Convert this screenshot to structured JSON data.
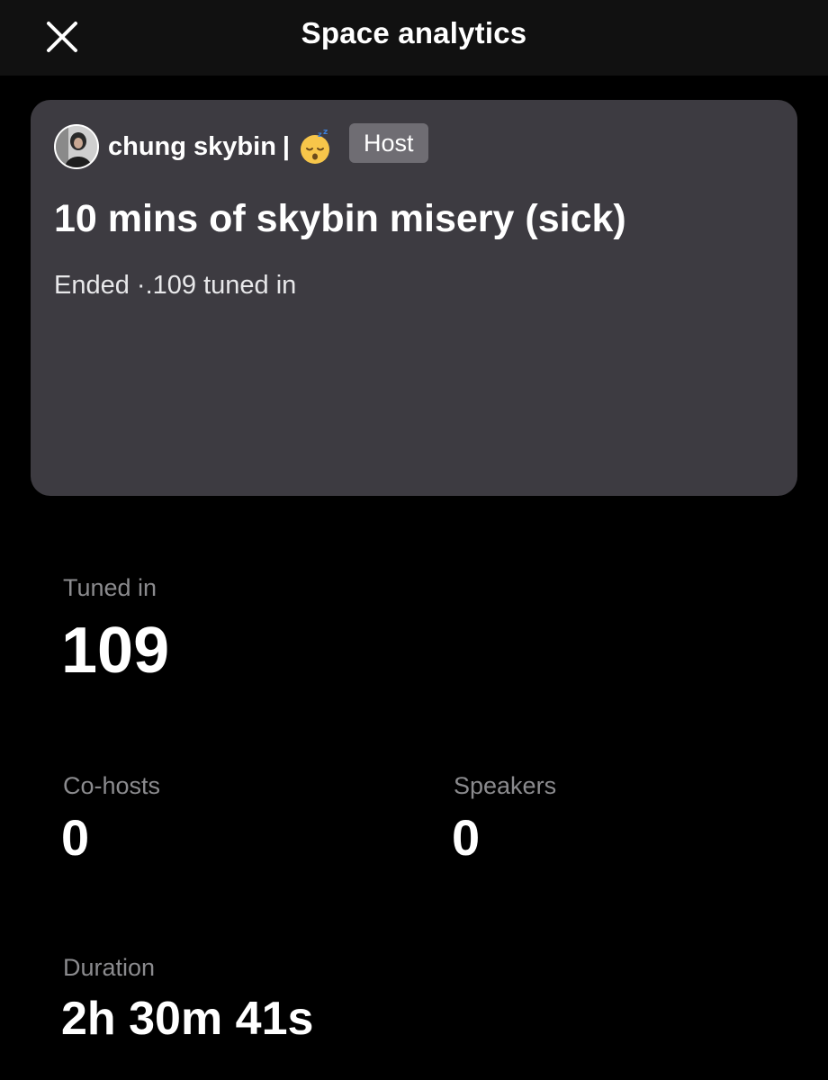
{
  "header": {
    "title": "Space analytics",
    "close_icon": "close-icon"
  },
  "space": {
    "host_name": "chung skybin",
    "host_separator": "|",
    "host_emoji": "sleeping-face-emoji",
    "host_badge": "Host",
    "title": "10 mins of skybin misery (sick)",
    "status": "Ended ·.109 tuned in"
  },
  "stats": {
    "tuned_in": {
      "label": "Tuned in",
      "value": "109"
    },
    "cohosts": {
      "label": "Co-hosts",
      "value": "0"
    },
    "speakers": {
      "label": "Speakers",
      "value": "0"
    },
    "duration": {
      "label": "Duration",
      "value": "2h 30m 41s"
    }
  },
  "colors": {
    "background": "#000000",
    "header_bg": "#111111",
    "card_bg": "#3d3b41",
    "badge_bg": "#6f6d73",
    "label_gray": "#8b8b8e",
    "text": "#ffffff"
  }
}
